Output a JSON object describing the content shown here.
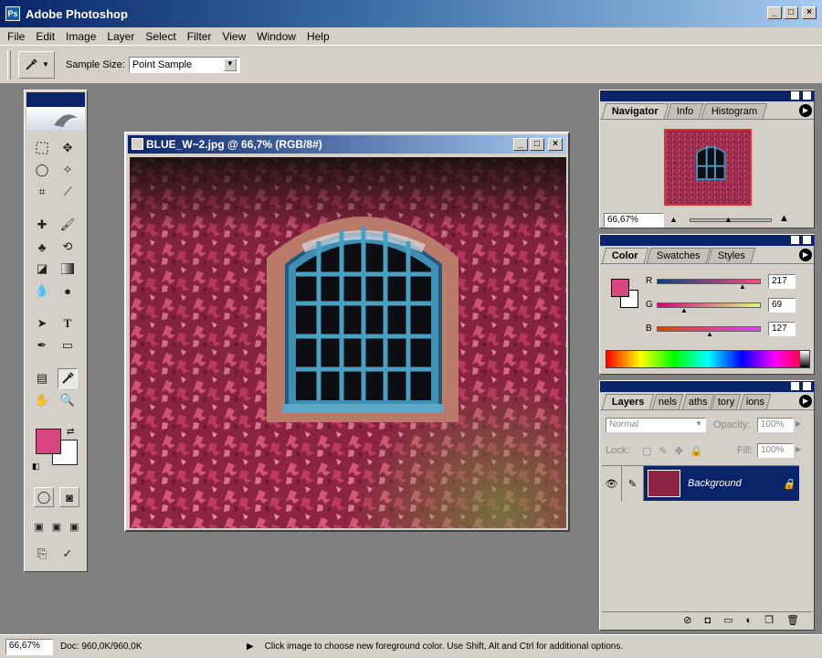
{
  "app": {
    "title": "Adobe Photoshop",
    "logo_icon": "photoshop-logo-icon",
    "minimize": "_",
    "maximize": "□",
    "close": "×"
  },
  "menu": [
    "File",
    "Edit",
    "Image",
    "Layer",
    "Select",
    "Filter",
    "View",
    "Window",
    "Help"
  ],
  "options": {
    "sample_size_label": "Sample Size:",
    "sample_size_value": "Point Sample",
    "tool_icon": "eyedropper-icon"
  },
  "document": {
    "title": "BLUE_W~2.jpg @ 66,7% (RGB/8#)",
    "minimize": "_",
    "maximize": "□",
    "close": "×"
  },
  "navigator": {
    "tabs": [
      "Navigator",
      "Info",
      "Histogram"
    ],
    "zoom": "66,67%"
  },
  "color_panel": {
    "tabs": [
      "Color",
      "Swatches",
      "Styles"
    ],
    "channels": [
      {
        "label": "R",
        "value": "217"
      },
      {
        "label": "G",
        "value": "69"
      },
      {
        "label": "B",
        "value": "127"
      }
    ],
    "foreground": "#d9457f",
    "background": "#ffffff"
  },
  "layers": {
    "tabs": [
      "Layers",
      "nels",
      "aths",
      "tory",
      "ions"
    ],
    "blend_mode": "Normal",
    "opacity_label": "Opacity:",
    "opacity_value": "100%",
    "lock_label": "Lock:",
    "fill_label": "Fill:",
    "fill_value": "100%",
    "layer_name": "Background"
  },
  "status": {
    "zoom": "66,67%",
    "doc": "Doc: 960,0K/960,0K",
    "message": "Click image to choose new foreground color.  Use Shift, Alt and Ctrl for additional options."
  },
  "colors": {
    "accent": "#0a246a",
    "ivy": "#b8325a",
    "window_frame": "#3f8fb5"
  }
}
